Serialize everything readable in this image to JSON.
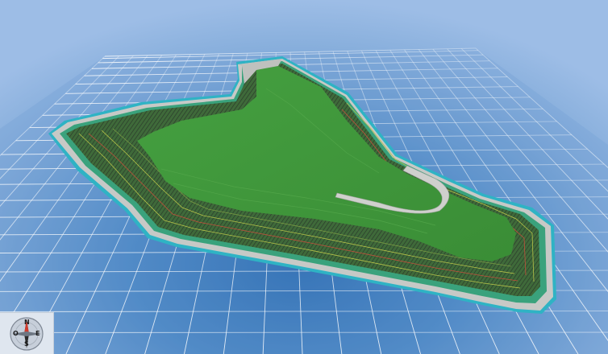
{
  "scene": {
    "background_top": "#9dbde6",
    "background_center": "#2f6fb3",
    "grid_color": "#dbe8f7",
    "terrain_top_color": "#3e8f3a",
    "slope_color": "#4f6b45",
    "road_color": "#c9ccc9",
    "water_edge_color": "#2fb3c4"
  },
  "compass": {
    "north": "N",
    "south": "S",
    "west": "O",
    "east": "E",
    "icon": "compass-icon"
  }
}
